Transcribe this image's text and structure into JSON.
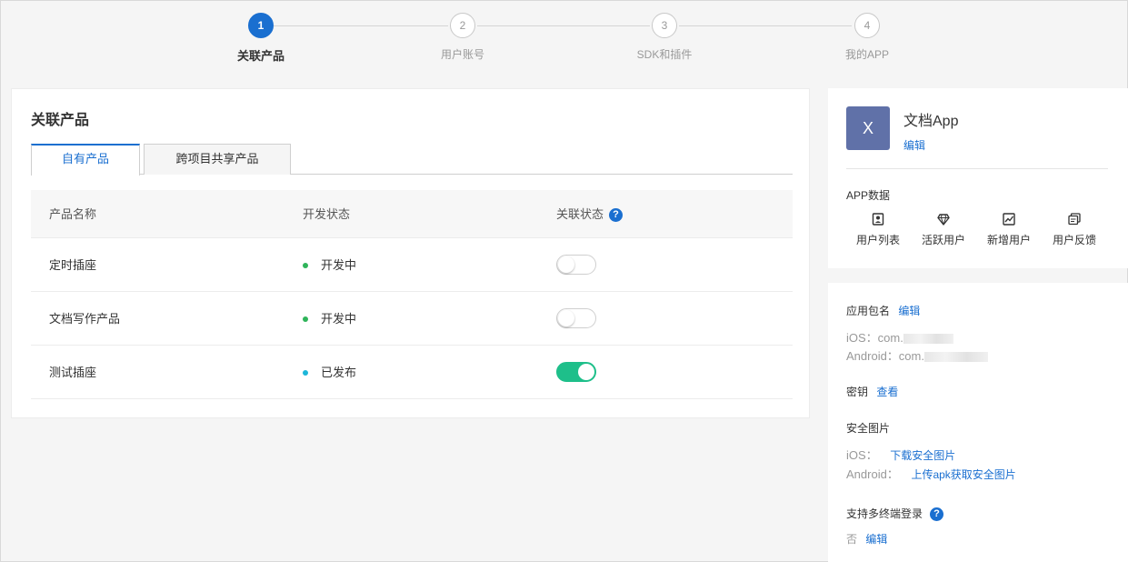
{
  "steps": [
    {
      "num": "1",
      "label": "关联产品"
    },
    {
      "num": "2",
      "label": "用户账号"
    },
    {
      "num": "3",
      "label": "SDK和插件"
    },
    {
      "num": "4",
      "label": "我的APP"
    }
  ],
  "main": {
    "title": "关联产品",
    "tabs": [
      "自有产品",
      "跨项目共享产品"
    ],
    "table": {
      "headers": [
        "产品名称",
        "开发状态",
        "关联状态"
      ],
      "help": "?",
      "rows": [
        {
          "name": "定时插座",
          "status": "开发中",
          "linked": false
        },
        {
          "name": "文档写作产品",
          "status": "开发中",
          "linked": false
        },
        {
          "name": "测试插座",
          "status": "已发布",
          "linked": true
        }
      ]
    }
  },
  "app": {
    "icon_letter": "X",
    "name": "文档App",
    "edit": "编辑",
    "data_title": "APP数据",
    "stats": [
      "用户列表",
      "活跃用户",
      "新增用户",
      "用户反馈"
    ]
  },
  "settings": {
    "package_label": "应用包名",
    "package_edit": "编辑",
    "ios_prefix": "iOS：com.",
    "android_prefix": "Android：com.",
    "secret_label": "密钥",
    "secret_view": "查看",
    "security_label": "安全图片",
    "ios_label": "iOS：",
    "ios_download": "下载安全图片",
    "android_label": "Android：",
    "android_upload": "上传apk获取安全图片",
    "multi_login_label": "支持多终端登录",
    "multi_login_value": "否",
    "multi_login_edit": "编辑",
    "help": "?"
  },
  "colors": {
    "primary": "#1a6fd0",
    "switch_on": "#1ebf8a",
    "dev_dot": "#2fb45a",
    "published_dot": "#1cb6d9",
    "app_icon_bg": "#6071a8"
  }
}
